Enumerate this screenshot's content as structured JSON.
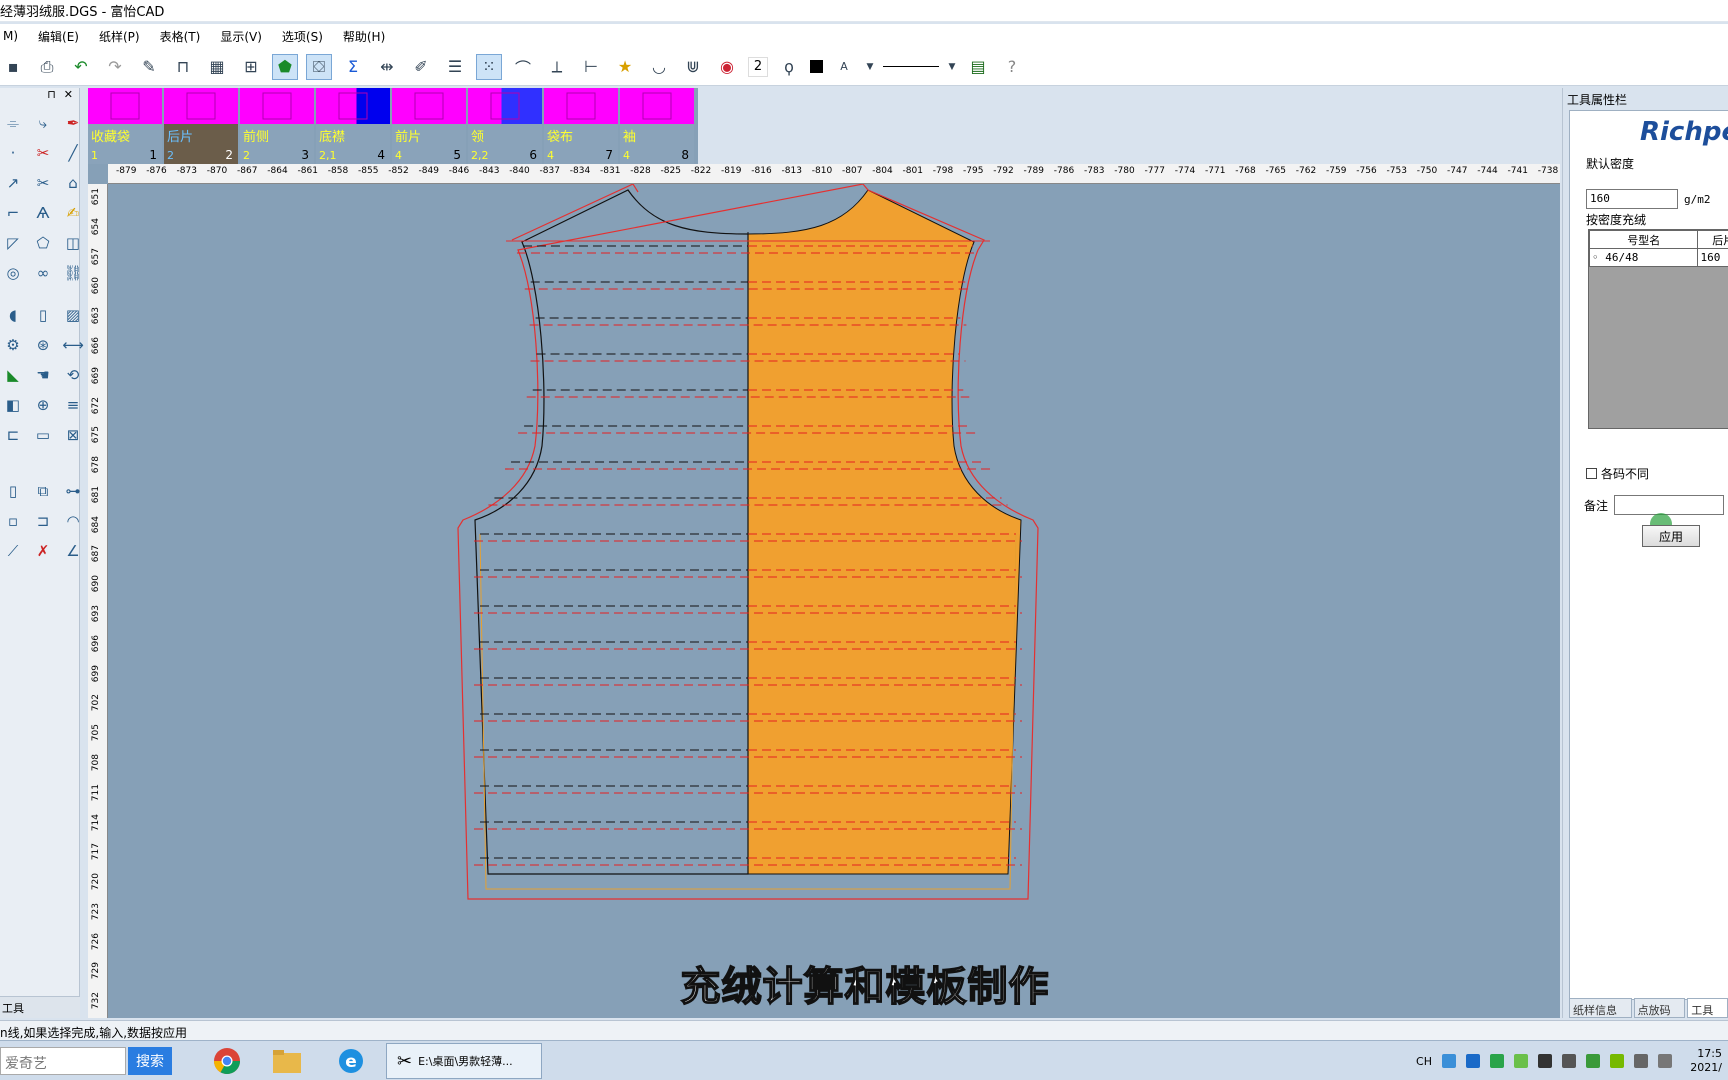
{
  "window": {
    "title": "经薄羽绒服.DGS - 富怡CAD"
  },
  "menu": [
    "M)",
    "编辑(E)",
    "纸样(P)",
    "表格(T)",
    "显示(V)",
    "选项(S)",
    "帮助(H)"
  ],
  "toolbar": {
    "pen_number": "2",
    "text_tool": "A"
  },
  "left_panel": {
    "pin": "⊓",
    "close": "✕",
    "footer_tab": "工具"
  },
  "pieces": [
    {
      "name": "收藏袋",
      "count": "1",
      "index": "1"
    },
    {
      "name": "后片",
      "count": "2",
      "index": "2",
      "selected": true
    },
    {
      "name": "前侧",
      "count": "2",
      "index": "3"
    },
    {
      "name": "底襟",
      "count": "2,1",
      "index": "4"
    },
    {
      "name": "前片",
      "count": "4",
      "index": "5"
    },
    {
      "name": "领",
      "count": "2,2",
      "index": "6"
    },
    {
      "name": "袋布",
      "count": "4",
      "index": "7"
    },
    {
      "name": "袖",
      "count": "4",
      "index": "8"
    }
  ],
  "ruler": {
    "top": [
      "-879",
      "-876",
      "-873",
      "-870",
      "-867",
      "-864",
      "-861",
      "-858",
      "-855",
      "-852",
      "-849",
      "-846",
      "-843",
      "-840",
      "-837",
      "-834",
      "-831",
      "-828",
      "-825",
      "-822",
      "-819",
      "-816",
      "-813",
      "-810",
      "-807",
      "-804",
      "-801",
      "-798",
      "-795",
      "-792",
      "-789",
      "-786",
      "-783",
      "-780",
      "-777",
      "-774",
      "-771",
      "-768",
      "-765",
      "-762",
      "-759",
      "-756",
      "-753",
      "-750",
      "-747",
      "-744",
      "-741",
      "-738"
    ],
    "left": [
      "651",
      "654",
      "657",
      "660",
      "663",
      "666",
      "669",
      "672",
      "675",
      "678",
      "681",
      "684",
      "687",
      "690",
      "693",
      "696",
      "699",
      "702",
      "705",
      "708",
      "711",
      "714",
      "717",
      "720",
      "723",
      "726",
      "729",
      "732"
    ]
  },
  "subtitle": "充绒计算和模板制作",
  "right_panel": {
    "title": "工具属性栏",
    "logo": "Richpe",
    "default_density_label": "默认密度",
    "default_density_value": "160",
    "unit": "g/m2",
    "fill_by_density_label": "按密度充绒",
    "table_headers": [
      "号型名",
      "后片"
    ],
    "table_rows": [
      [
        "46/48",
        "160"
      ]
    ],
    "different_sizes_label": "各码不同",
    "note_label": "备注",
    "apply_button": "应用",
    "tabs": [
      "纸样信息栏",
      "点放码表",
      "工具属"
    ]
  },
  "status_text": "n线,如果选择完成,输入,数据按应用",
  "taskbar": {
    "search_placeholder": "爱奇艺",
    "search_button": "搜索",
    "task_item": "E:\\桌面\\男款轻薄...",
    "tray_lang": "CH",
    "clock_time": "17:5",
    "clock_date": "2021/"
  },
  "colors": {
    "piece_fill": "#f0a030",
    "canvas_bg": "#86a0b7",
    "strip_magenta": "#ff00ff",
    "stitch_red": "#e52020",
    "outline_red": "#e53030"
  }
}
